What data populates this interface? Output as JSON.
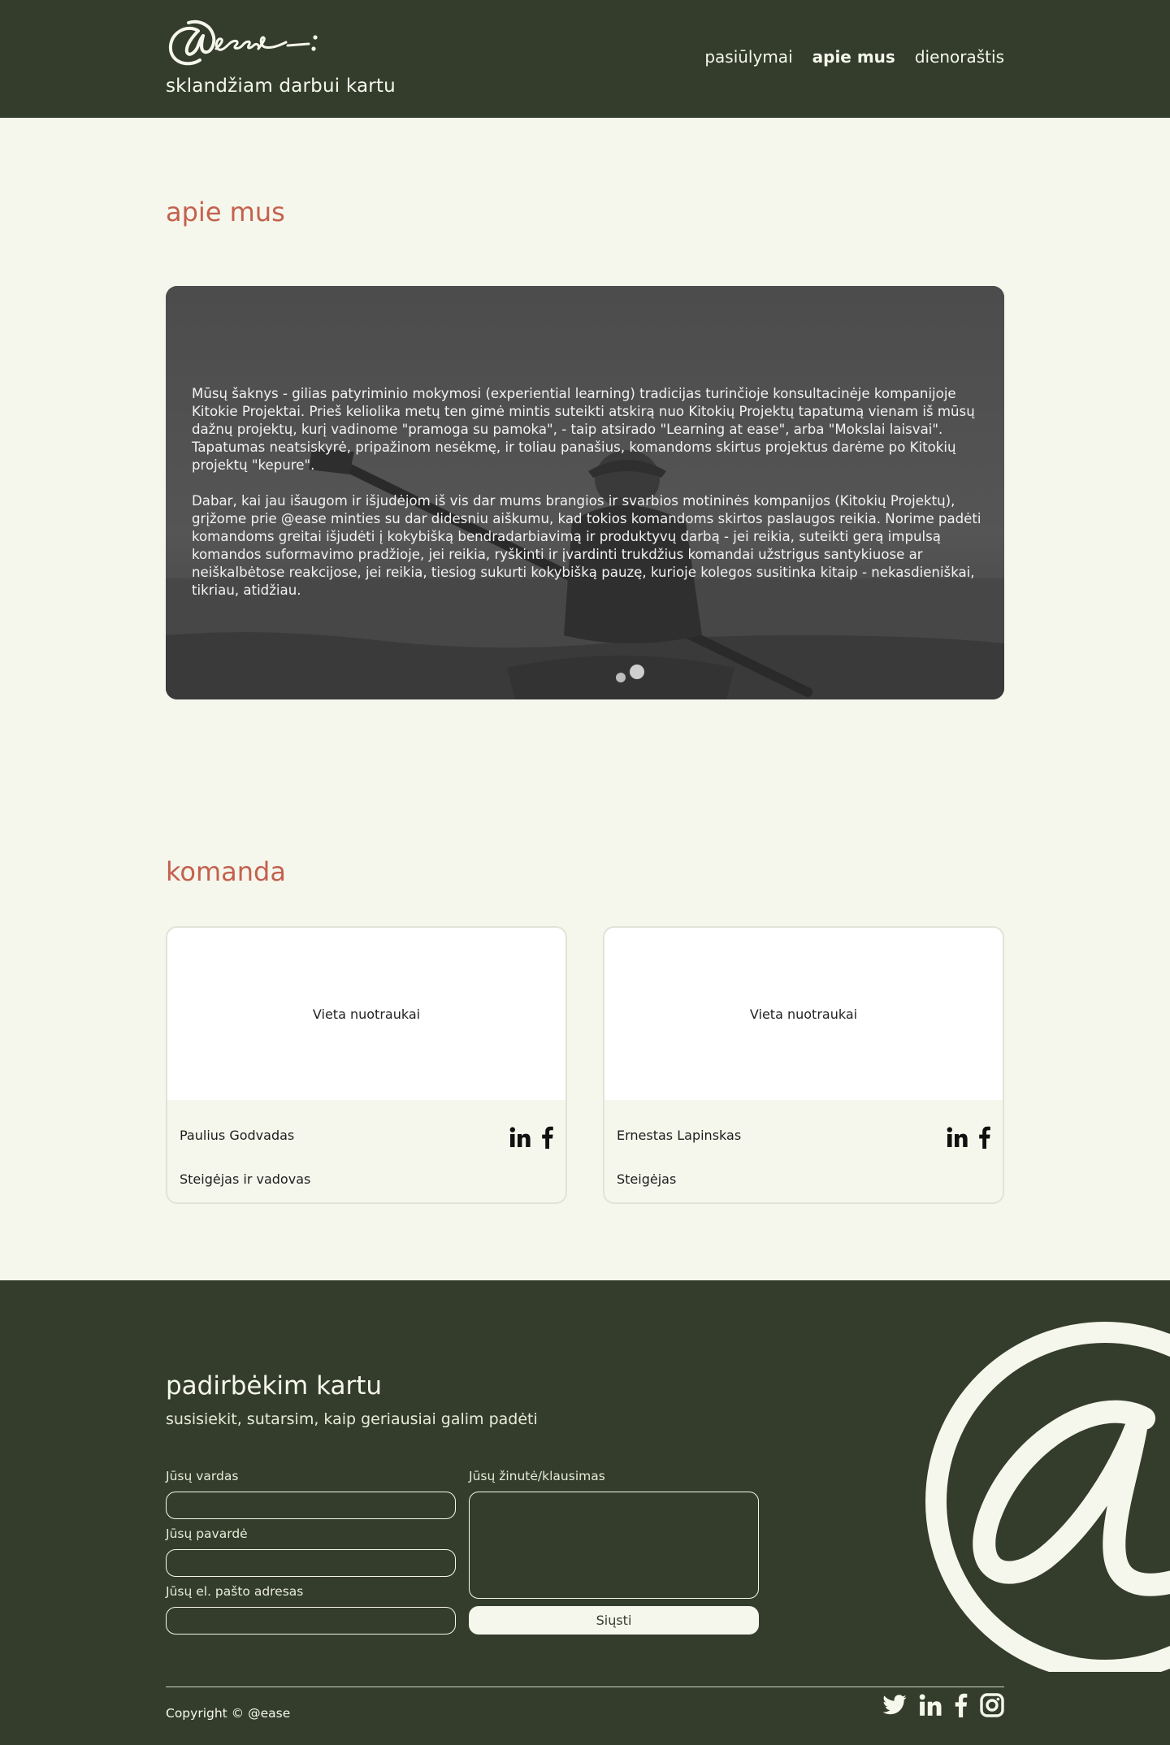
{
  "header": {
    "logo_text": "@ease:",
    "tagline": "sklandžiam darbui kartu",
    "nav": [
      {
        "label": "pasiūlymai",
        "active": false
      },
      {
        "label": "apie mus",
        "active": true
      },
      {
        "label": "dienoraštis",
        "active": false
      }
    ]
  },
  "about": {
    "title": "apie mus",
    "paragraphs": [
      "Mūsų šaknys - gilias patyriminio mokymosi (experiential learning) tradicijas turinčioje konsultacinėje kompanijoje Kitokie Projektai. Prieš  keliolika metų ten gimė mintis suteikti atskirą nuo Kitokių Projektų tapatumą vienam iš mūsų dažnų projektų, kurį vadinome \"pramoga su  pamoka\", - taip atsirado \"Learning at ease\", arba \"Mokslai laisvai\".  Tapatumas neatsiskyrė, pripažinom nesėkmę, ir toliau panašius, komandoms skirtus projektus darėme po Kitokių projektų \"kepure\".",
      "Dabar, kai jau išaugom ir išjudėjom iš vis dar mums brangios ir svarbios motininės kompanijos (Kitokių Projektų), grįžome prie @ease minties su  dar didesniu aiškumu, kad tokios komandoms skirtos paslaugos reikia.  Norime padėti komandoms greitai išjudėti į kokybišką bendradarbiavimą ir produktyvų darbą - jei reikia, suteikti gerą impulsą  komandos  suformavimo pradžioje, jei reikia, ryškinti ir įvardinti trukdžius komandai užstrigus santykiuose ar neiškalbėtose reakcijose, jei reikia,  tiesiog sukurti kokybišką pauzę, kurioje kolegos susitinka kitaip -  nekasdieniškai, tikriau, atidžiau."
    ]
  },
  "team": {
    "title": "komanda",
    "members": [
      {
        "photo_placeholder": "Vieta nuotraukai",
        "name": "Paulius Godvadas",
        "role": "Steigėjas ir vadovas"
      },
      {
        "photo_placeholder": "Vieta nuotraukai",
        "name": "Ernestas Lapinskas",
        "role": "Steigėjas"
      }
    ],
    "social_icons": [
      "linkedin-icon",
      "facebook-icon"
    ]
  },
  "footer": {
    "title": "padirbėkim kartu",
    "subtitle": "susisiekit, sutarsim, kaip geriausiai galim padėti",
    "form": {
      "first_name_label": "Jūsų vardas",
      "first_name_value": "",
      "last_name_label": "Jūsų pavardė",
      "last_name_value": "",
      "email_label": "Jūsų el. pašto adresas",
      "email_value": "",
      "message_label": "Jūsų žinutė/klausimas",
      "message_value": "",
      "send_label": "Siųsti"
    },
    "copyright": "Copyright © @ease",
    "social_icons": [
      "twitter-icon",
      "linkedin-icon",
      "facebook-icon",
      "instagram-icon"
    ]
  },
  "colors": {
    "dark_green": "#343d2c",
    "cream": "#f6f7ec",
    "accent": "#c4604e"
  }
}
